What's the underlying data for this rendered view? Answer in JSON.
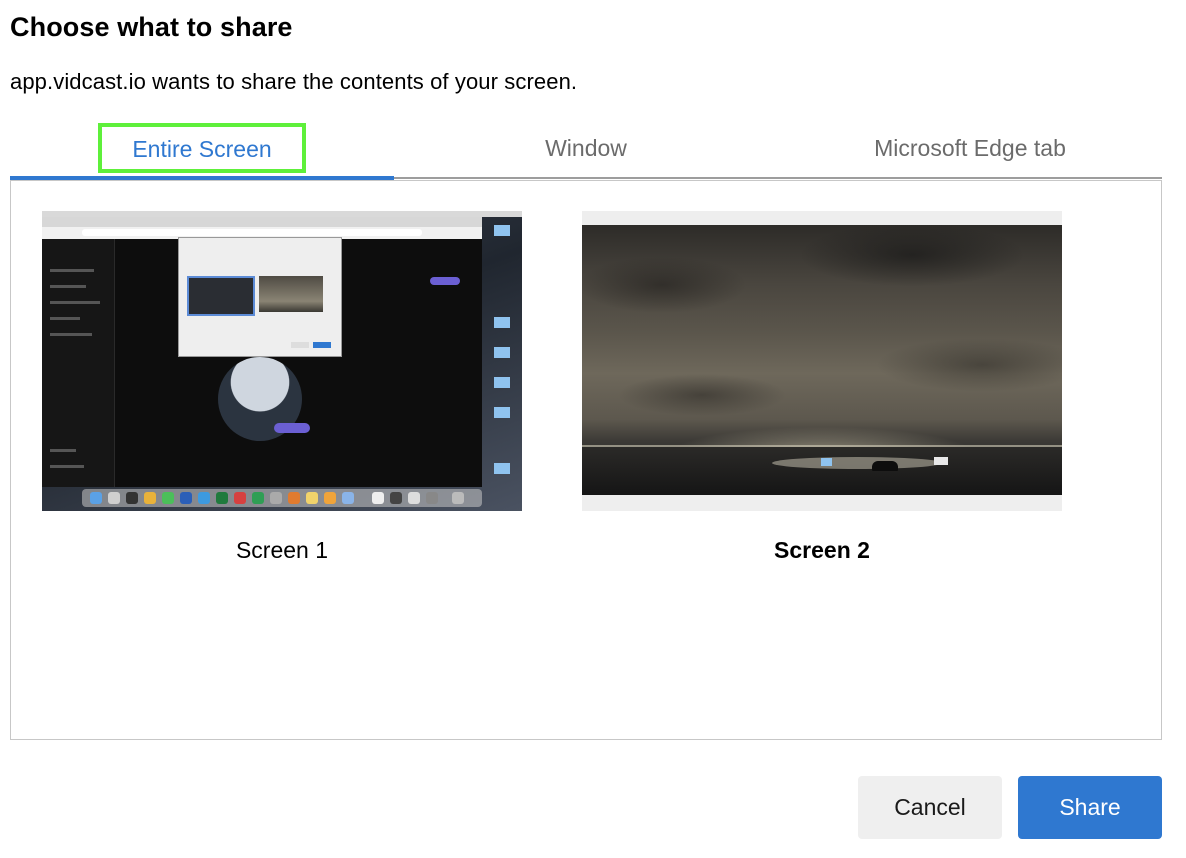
{
  "dialog": {
    "title": "Choose what to share",
    "subtitle": "app.vidcast.io wants to share the contents of your screen."
  },
  "tabs": [
    {
      "label": "Entire Screen",
      "active": true
    },
    {
      "label": "Window",
      "active": false
    },
    {
      "label": "Microsoft Edge tab",
      "active": false
    }
  ],
  "sources": [
    {
      "label": "Screen 1",
      "selected": false
    },
    {
      "label": "Screen 2",
      "selected": true
    }
  ],
  "buttons": {
    "cancel": "Cancel",
    "share": "Share"
  },
  "colors": {
    "accent": "#2f78d0",
    "highlight_outline": "#5ef03a",
    "inactive_tab_text": "#6b6b6b",
    "cancel_bg": "#efefef"
  }
}
